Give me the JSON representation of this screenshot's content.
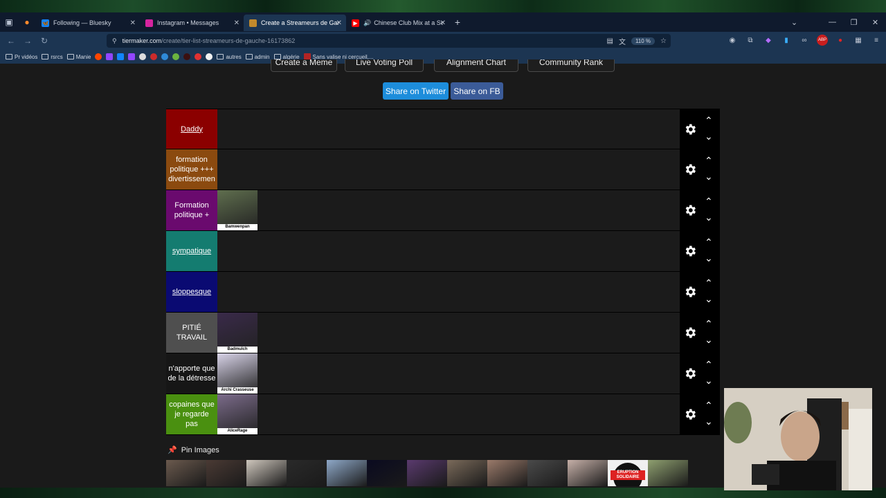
{
  "browser": {
    "tabs": [
      {
        "label": "Following — Bluesky",
        "icon_color": "#1185fe"
      },
      {
        "label": "Instagram • Messages",
        "icon_color": "#d6249f"
      },
      {
        "label": "Create a Streameurs de Gauche",
        "icon_color": "#c28a2c",
        "active": true
      },
      {
        "label": "Chinese Club Mix at a Senio",
        "icon_color": "#ff0000"
      }
    ],
    "url_domain": "tiermaker.com",
    "url_path": "/create/tier-list-streameurs-de-gauche-16173862",
    "zoom": "110 %",
    "bookmarks": [
      {
        "label": "Pr vidéos",
        "type": "folder"
      },
      {
        "label": "rsrcs",
        "type": "folder"
      },
      {
        "label": "Manie",
        "type": "folder"
      },
      {
        "label": "autres",
        "type": "folder"
      },
      {
        "label": "admin",
        "type": "folder"
      },
      {
        "label": "algérie",
        "type": "folder"
      },
      {
        "label": "Sans valise ni cercueil,...",
        "type": "link"
      }
    ]
  },
  "page": {
    "top_buttons": [
      "Create a Meme",
      "Live Voting Poll",
      "Alignment Chart",
      "Community Rank"
    ],
    "share_twitter": "Share on Twitter",
    "share_fb": "Share on FB",
    "tiers": [
      {
        "label": "Daddy",
        "color": "#8b0000",
        "underline": true,
        "items": []
      },
      {
        "label": "formation politique +++ divertissemen",
        "color": "#8b4a0f",
        "underline": false,
        "items": []
      },
      {
        "label": "Formation politique +",
        "color": "#6a0a6e",
        "underline": false,
        "items": [
          {
            "caption": "Bamwenpan",
            "bg": "#5f6e4e"
          }
        ]
      },
      {
        "label": "sympatique",
        "color": "#147c70",
        "underline": true,
        "items": []
      },
      {
        "label": "sloppesque",
        "color": "#0a0a72",
        "underline": true,
        "items": []
      },
      {
        "label": "PITIÉ TRAVAIL",
        "color": "#4f4f4f",
        "underline": false,
        "items": [
          {
            "caption": "Badmulch",
            "bg": "#3a2a4a"
          }
        ]
      },
      {
        "label": "n'apporte que de la détresse",
        "color": "#161616",
        "underline": false,
        "items": [
          {
            "caption": "Archi Crasseuse",
            "bg": "#d8d3e8"
          }
        ]
      },
      {
        "label": "copaines que je regarde pas",
        "color": "#4a9010",
        "underline": false,
        "items": [
          {
            "caption": "AliceRage",
            "bg": "#7b6b8a"
          }
        ]
      }
    ],
    "pin_label": "Pin Images",
    "thumbnails": [
      "#6b5a4e",
      "#4a3a34",
      "#cfc7bd",
      "#2a2a2a",
      "#8ea8c8",
      "#0a0a20",
      "#5a3a6e",
      "#7a6a5a",
      "#9a7a6a",
      "#4a4a4a",
      "#c6b0a8",
      "#1a1a1a",
      "#8fa070"
    ],
    "thumbnail_text": "ERUPTION SOLIDAIRE"
  }
}
